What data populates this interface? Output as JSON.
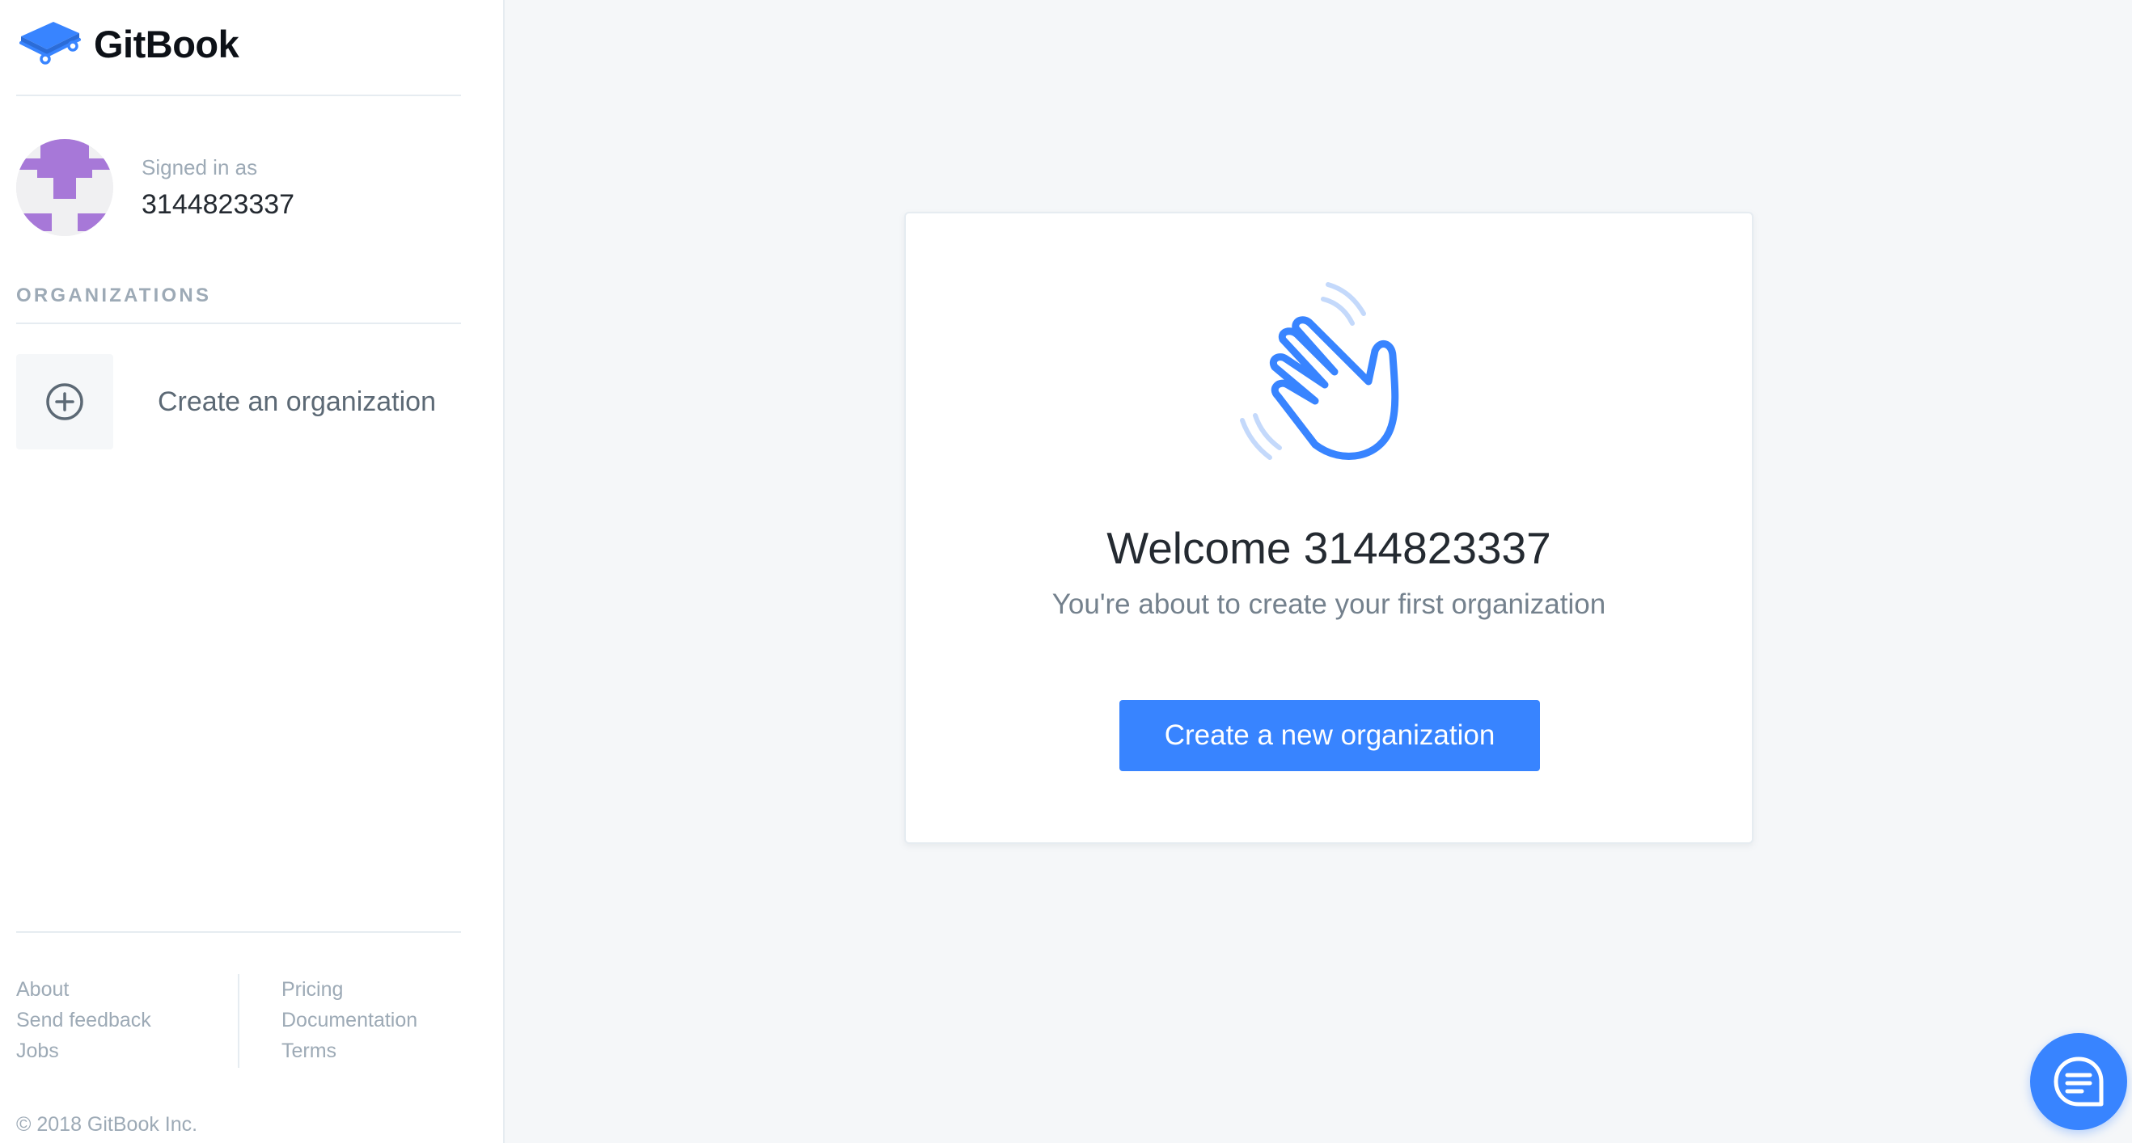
{
  "brand": {
    "name": "GitBook",
    "logo_icon": "gitbook-book-icon"
  },
  "user": {
    "signed_in_label": "Signed in as",
    "username": "3144823337"
  },
  "sidebar": {
    "section_title": "ORGANIZATIONS",
    "create_org_label": "Create an organization",
    "create_org_icon": "plus-circle-icon"
  },
  "footer": {
    "col1": [
      "About",
      "Send feedback",
      "Jobs"
    ],
    "col2": [
      "Pricing",
      "Documentation",
      "Terms"
    ],
    "copyright": "© 2018 GitBook Inc."
  },
  "main": {
    "illustration": "waving-hand-icon",
    "welcome_title": "Welcome 3144823337",
    "welcome_subtitle": "You're about to create your first organization",
    "cta_label": "Create a new organization"
  },
  "chat": {
    "icon": "chat-bubble-icon"
  },
  "colors": {
    "accent": "#3884ff",
    "avatar_purple": "#a778d8"
  }
}
